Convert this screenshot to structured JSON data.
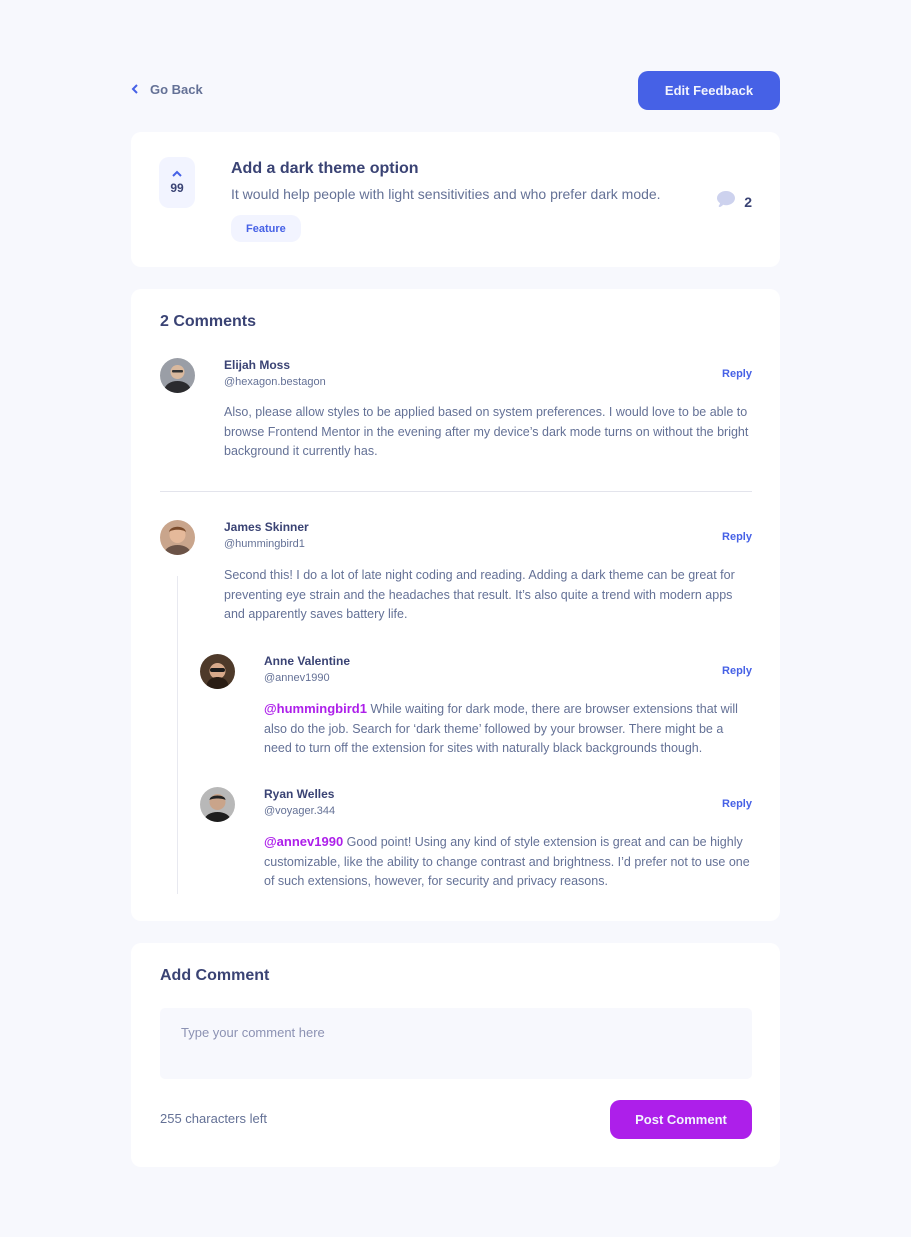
{
  "nav": {
    "back_label": "Go Back",
    "edit_label": "Edit Feedback"
  },
  "feedback": {
    "upvotes": "99",
    "title": "Add a dark theme option",
    "description": "It would help people with light sensitivities and who prefer dark mode.",
    "tag": "Feature",
    "comment_count": "2"
  },
  "comments_section": {
    "title": "2 Comments",
    "items": [
      {
        "name": "Elijah Moss",
        "username": "@hexagon.bestagon",
        "reply_label": "Reply",
        "content": "Also, please allow styles to be applied based on system preferences. I would love to be able to browse Frontend Mentor in the evening after my device’s dark mode turns on without the bright background it currently has."
      },
      {
        "name": "James Skinner",
        "username": "@hummingbird1",
        "reply_label": "Reply",
        "content": "Second this! I do a lot of late night coding and reading. Adding a dark theme can be great for preventing eye strain and the headaches that result. It’s also quite a trend with modern apps and apparently saves battery life.",
        "replies": [
          {
            "name": "Anne Valentine",
            "username": "@annev1990",
            "reply_label": "Reply",
            "mention": "@hummingbird1",
            "content": "While waiting for dark mode, there are browser extensions that will also do the job. Search for ‘dark theme’ followed by your browser. There might be a need to turn off the extension for sites with naturally black backgrounds though."
          },
          {
            "name": "Ryan Welles",
            "username": "@voyager.344",
            "reply_label": "Reply",
            "mention": "@annev1990",
            "content": "Good point! Using any kind of style extension is great and can be highly customizable, like the ability to change contrast and brightness. I’d prefer not to use one of such extensions, however, for security and privacy reasons."
          }
        ]
      }
    ]
  },
  "add_comment": {
    "title": "Add Comment",
    "placeholder": "Type your comment here",
    "chars_left": "255 characters left",
    "submit_label": "Post Comment"
  },
  "colors": {
    "background": "#f7f8fd",
    "primary_blue": "#4661e6",
    "purple": "#ad1fea",
    "dark_text": "#3a4374",
    "muted_text": "#647196"
  }
}
